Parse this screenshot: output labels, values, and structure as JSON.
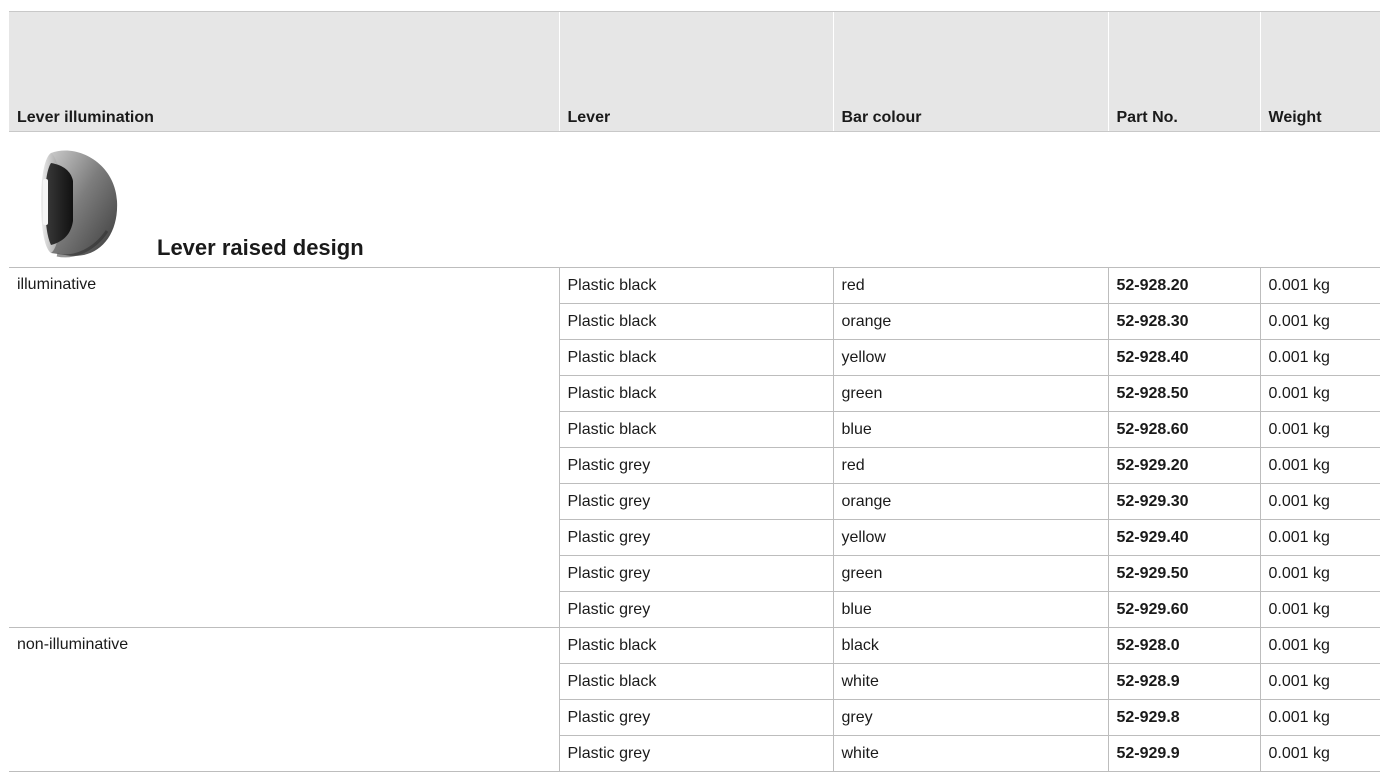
{
  "table": {
    "headers": [
      "Lever illumination",
      "Lever",
      "Bar colour",
      "Part No.",
      "Weight"
    ],
    "section_title": "Lever raised design",
    "section_image_icon": "lever-knob-image",
    "groups": [
      {
        "illumination": "illuminative",
        "rows": [
          {
            "lever": "Plastic black",
            "colour": "red",
            "part": "52-928.20",
            "weight": "0.001 kg"
          },
          {
            "lever": "Plastic black",
            "colour": "orange",
            "part": "52-928.30",
            "weight": "0.001 kg"
          },
          {
            "lever": "Plastic black",
            "colour": "yellow",
            "part": "52-928.40",
            "weight": "0.001 kg"
          },
          {
            "lever": "Plastic black",
            "colour": "green",
            "part": "52-928.50",
            "weight": "0.001 kg"
          },
          {
            "lever": "Plastic black",
            "colour": "blue",
            "part": "52-928.60",
            "weight": "0.001 kg"
          },
          {
            "lever": "Plastic grey",
            "colour": "red",
            "part": "52-929.20",
            "weight": "0.001 kg"
          },
          {
            "lever": "Plastic grey",
            "colour": "orange",
            "part": "52-929.30",
            "weight": "0.001 kg"
          },
          {
            "lever": "Plastic grey",
            "colour": "yellow",
            "part": "52-929.40",
            "weight": "0.001 kg"
          },
          {
            "lever": "Plastic grey",
            "colour": "green",
            "part": "52-929.50",
            "weight": "0.001 kg"
          },
          {
            "lever": "Plastic grey",
            "colour": "blue",
            "part": "52-929.60",
            "weight": "0.001 kg"
          }
        ]
      },
      {
        "illumination": "non-illuminative",
        "rows": [
          {
            "lever": "Plastic black",
            "colour": "black",
            "part": "52-928.0",
            "weight": "0.001 kg"
          },
          {
            "lever": "Plastic black",
            "colour": "white",
            "part": "52-928.9",
            "weight": "0.001 kg"
          },
          {
            "lever": "Plastic grey",
            "colour": "grey",
            "part": "52-929.8",
            "weight": "0.001 kg"
          },
          {
            "lever": "Plastic grey",
            "colour": "white",
            "part": "52-929.9",
            "weight": "0.001 kg"
          }
        ]
      }
    ]
  }
}
